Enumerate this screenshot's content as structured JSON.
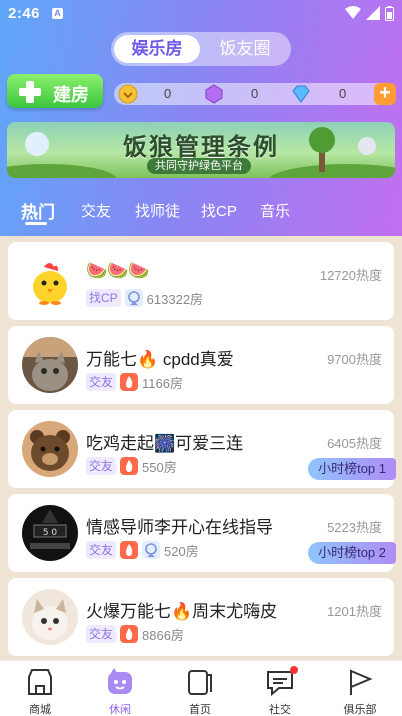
{
  "status": {
    "time": "2:46",
    "notification": "A"
  },
  "segment": {
    "active": "娱乐房",
    "inactive": "饭友圈"
  },
  "build_button": "建房",
  "currency": [
    {
      "icon": "coin-icon",
      "value": "0"
    },
    {
      "icon": "gem-icon",
      "value": "0"
    },
    {
      "icon": "diamond-icon",
      "value": "0"
    }
  ],
  "banner": {
    "title": "饭狼管理条例",
    "subtitle": "共同守护绿色平台"
  },
  "tabs": [
    "热门",
    "交友",
    "找师徒",
    "找CP",
    "音乐"
  ],
  "rooms": [
    {
      "title": "🍉🍉🍉",
      "tags": [
        "找CP"
      ],
      "icons": [
        "badge-icon"
      ],
      "count": "613322房",
      "heat": "12720热度",
      "avatar": "chick-avatar",
      "rank": ""
    },
    {
      "title": "万能七🔥 cpdd真爱",
      "tags": [
        "交友"
      ],
      "icons": [
        "fire-icon"
      ],
      "count": "1166房",
      "heat": "9700热度",
      "avatar": "cat-avatar",
      "rank": ""
    },
    {
      "title": "吃鸡走起🎆可爱三连",
      "tags": [
        "交友"
      ],
      "icons": [
        "fire-icon"
      ],
      "count": "550房",
      "heat": "6405热度",
      "avatar": "bear-avatar",
      "rank": "小时榜top 1"
    },
    {
      "title": "情感导师李开心在线指导",
      "tags": [
        "交友"
      ],
      "icons": [
        "fire-icon",
        "badge-icon"
      ],
      "count": "520房",
      "heat": "5223热度",
      "avatar": "stage-avatar",
      "rank": "小时榜top 2"
    },
    {
      "title": "火爆万能七🔥周末尤嗨皮",
      "tags": [
        "交友"
      ],
      "icons": [
        "fire-icon"
      ],
      "count": "8866房",
      "heat": "1201热度",
      "avatar": "kitten-avatar",
      "rank": ""
    }
  ],
  "nav": [
    {
      "label": "商城",
      "icon": "shop-icon"
    },
    {
      "label": "休闲",
      "icon": "leisure-icon",
      "active": true
    },
    {
      "label": "首页",
      "icon": "home-card-icon"
    },
    {
      "label": "社交",
      "icon": "chat-icon",
      "badge": true
    },
    {
      "label": "俱乐部",
      "icon": "flag-icon"
    }
  ],
  "colors": {
    "accent": "#8b5cf0",
    "tag_bg": "#efeaff",
    "fire": "#ff6b4a",
    "green": "#3cc63e"
  }
}
